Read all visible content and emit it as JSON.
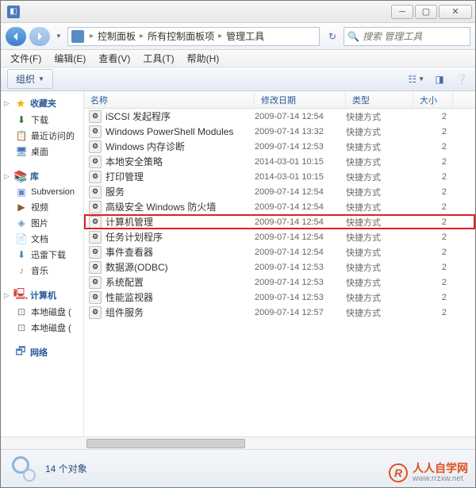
{
  "title": "管理工具",
  "breadcrumb": [
    "控制面板",
    "所有控制面板项",
    "管理工具"
  ],
  "search": {
    "placeholder": "搜索 管理工具"
  },
  "menu": [
    {
      "label": "文件(F)"
    },
    {
      "label": "编辑(E)"
    },
    {
      "label": "查看(V)"
    },
    {
      "label": "工具(T)"
    },
    {
      "label": "帮助(H)"
    }
  ],
  "toolbar": {
    "organize": "组织"
  },
  "sidebar": [
    {
      "label": "收藏夹",
      "icon": "★",
      "color": "#f0b000",
      "items": [
        {
          "label": "下载",
          "icon": "⬇",
          "color": "#2a7a2a"
        },
        {
          "label": "最近访问的",
          "icon": "📋",
          "color": "#c08030"
        },
        {
          "label": "桌面",
          "icon": "🖥",
          "color": "#4a7ac0"
        }
      ]
    },
    {
      "label": "库",
      "icon": "📚",
      "color": "#4a7ac0",
      "items": [
        {
          "label": "Subversion",
          "icon": "▣",
          "color": "#5a8aca"
        },
        {
          "label": "视频",
          "icon": "▶",
          "color": "#8a5a2a"
        },
        {
          "label": "图片",
          "icon": "◈",
          "color": "#5aa0c0"
        },
        {
          "label": "文档",
          "icon": "📄",
          "color": "#c0a060"
        },
        {
          "label": "迅雷下载",
          "icon": "⬇",
          "color": "#3a8ac0"
        },
        {
          "label": "音乐",
          "icon": "♪",
          "color": "#c09040"
        }
      ]
    },
    {
      "label": "计算机",
      "icon": "🖳",
      "color": "#d04040",
      "items": [
        {
          "label": "本地磁盘 (",
          "icon": "⊡",
          "color": "#808080"
        },
        {
          "label": "本地磁盘 (",
          "icon": "⊡",
          "color": "#808080"
        }
      ]
    },
    {
      "label": "网络",
      "icon": "🗗",
      "color": "#4a7ac0",
      "items": []
    }
  ],
  "columns": {
    "name": "名称",
    "date": "修改日期",
    "type": "类型",
    "size": "大小"
  },
  "files": [
    {
      "name": "iSCSI 发起程序",
      "date": "2009-07-14 12:54",
      "type": "快捷方式",
      "size": "2"
    },
    {
      "name": "Windows PowerShell Modules",
      "date": "2009-07-14 13:32",
      "type": "快捷方式",
      "size": "2"
    },
    {
      "name": "Windows 内存诊断",
      "date": "2009-07-14 12:53",
      "type": "快捷方式",
      "size": "2"
    },
    {
      "name": "本地安全策略",
      "date": "2014-03-01 10:15",
      "type": "快捷方式",
      "size": "2"
    },
    {
      "name": "打印管理",
      "date": "2014-03-01 10:15",
      "type": "快捷方式",
      "size": "2"
    },
    {
      "name": "服务",
      "date": "2009-07-14 12:54",
      "type": "快捷方式",
      "size": "2"
    },
    {
      "name": "高级安全 Windows 防火墙",
      "date": "2009-07-14 12:54",
      "type": "快捷方式",
      "size": "2"
    },
    {
      "name": "计算机管理",
      "date": "2009-07-14 12:54",
      "type": "快捷方式",
      "size": "2",
      "highlight": true
    },
    {
      "name": "任务计划程序",
      "date": "2009-07-14 12:54",
      "type": "快捷方式",
      "size": "2"
    },
    {
      "name": "事件查看器",
      "date": "2009-07-14 12:54",
      "type": "快捷方式",
      "size": "2"
    },
    {
      "name": "数据源(ODBC)",
      "date": "2009-07-14 12:53",
      "type": "快捷方式",
      "size": "2"
    },
    {
      "name": "系统配置",
      "date": "2009-07-14 12:53",
      "type": "快捷方式",
      "size": "2"
    },
    {
      "name": "性能监视器",
      "date": "2009-07-14 12:53",
      "type": "快捷方式",
      "size": "2"
    },
    {
      "name": "组件服务",
      "date": "2009-07-14 12:57",
      "type": "快捷方式",
      "size": "2"
    }
  ],
  "status": "14 个对象",
  "watermark": {
    "text": "人人自学网",
    "url": "www.rrzxw.net"
  }
}
